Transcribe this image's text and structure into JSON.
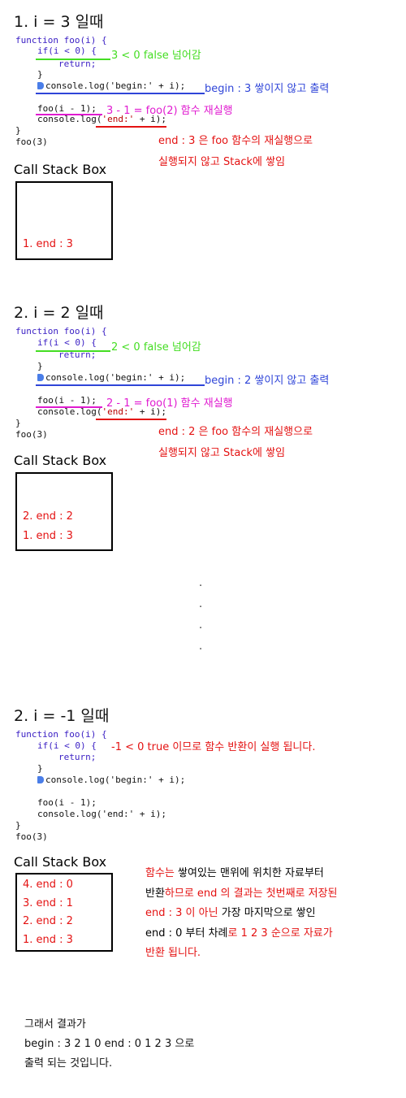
{
  "section1": {
    "title": "1. i = 3 일때",
    "code": {
      "l1": "function foo(i) {",
      "l2": "if(i < 0) {",
      "l3": "return;",
      "l4": "}",
      "l5": "console.log('begin:' + i);",
      "l6": "foo(i - 1);",
      "l7a": "console.log(",
      "l7b": "'end:'",
      "l7c": " + i);",
      "l8": "}",
      "l9": "foo(3)"
    },
    "ann_if": "3 < 0 false 넘어감",
    "ann_begin": "begin : 3 쌓이지 않고 출력",
    "ann_foo": "3 - 1 = foo(2) 함수 재실행",
    "ann_end1": "end : 3 은 foo 함수의 재실행으로",
    "ann_end2": "실행되지 않고 Stack에 쌓임",
    "stack_label": "Call Stack Box",
    "stack": [
      "1. end : 3"
    ]
  },
  "section2": {
    "title": "2. i = 2 일때",
    "code": {
      "l1": "function foo(i) {",
      "l2": "if(i < 0) {",
      "l3": "return;",
      "l4": "}",
      "l5": "console.log('begin:' + i);",
      "l6": "foo(i - 1);",
      "l7a": "console.log(",
      "l7b": "'end:'",
      "l7c": " + i);",
      "l8": "}",
      "l9": "foo(3)"
    },
    "ann_if": "2 < 0 false 넘어감",
    "ann_begin": "begin : 2 쌓이지 않고 출력",
    "ann_foo": "2 - 1 = foo(1) 함수 재실행",
    "ann_end1": "end : 2 은 foo 함수의 재실행으로",
    "ann_end2": "실행되지 않고 Stack에 쌓임",
    "stack_label": "Call Stack Box",
    "stack": [
      "2. end : 2",
      "1. end : 3"
    ]
  },
  "dots": ".",
  "section3": {
    "title": "2. i = -1 일때",
    "code": {
      "l1": "function foo(i) {",
      "l2": "if(i < 0) {",
      "l3": "return;",
      "l4": "}",
      "l5": "console.log('begin:' + i);",
      "l6": "foo(i - 1);",
      "l7": "console.log('end:' + i);",
      "l8": "}",
      "l9": "foo(3)"
    },
    "ann_if": "-1 < 0 true 이므로 함수 반환이 실행 됩니다.",
    "stack_label": "Call Stack Box",
    "stack": [
      "4. end : 0",
      "3. end : 1",
      "2. end : 2",
      "1. end : 3"
    ],
    "note": {
      "l1a": "함수는",
      "l1b": " 쌓여있는 맨위에 위치한 자료부터",
      "l2a": "반환",
      "l2b": "하므로 end 의 결과는 첫번째로 저장된",
      "l3a": "end : 3 이 아닌",
      "l3b": " 가장 마지막으로 쌓인",
      "l4a": "end : 0 부터 차례",
      "l4b": "로 1 2 3 순으로 자료가",
      "l5": "반환 됩니다."
    }
  },
  "summary": {
    "l1": "그래서 결과가",
    "l2": "begin : 3 2 1 0 end : 0 1 2 3 으로",
    "l3": "출력 되는 것입니다."
  }
}
